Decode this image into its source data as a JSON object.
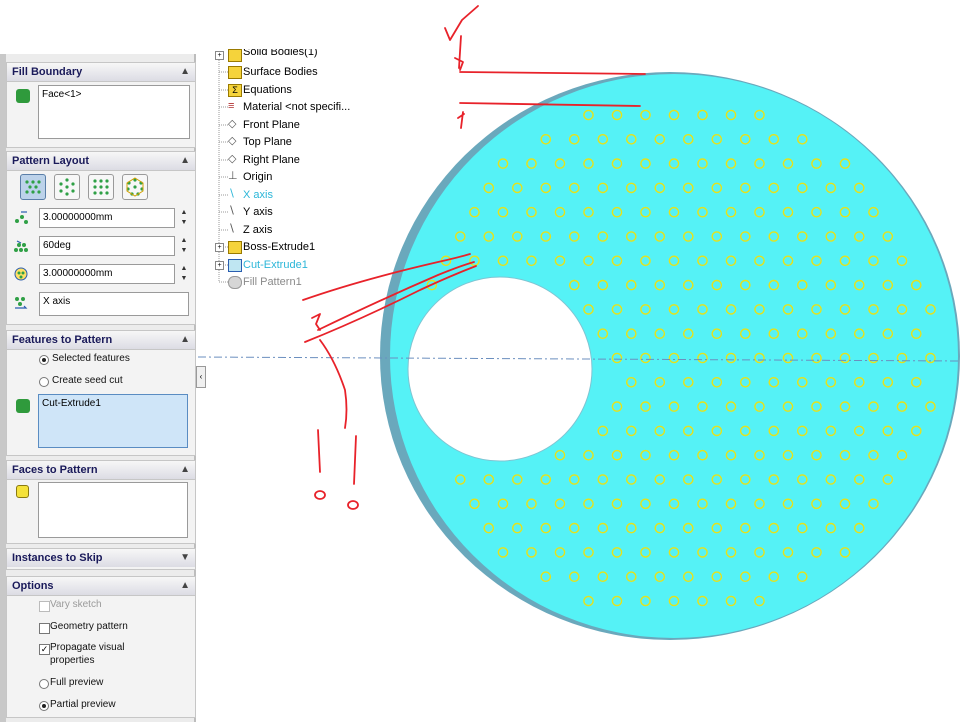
{
  "fill_boundary": {
    "header": "Fill Boundary",
    "selection": "Face<1>"
  },
  "pattern_layout": {
    "header": "Pattern Layout",
    "spacing": "3.00000000mm",
    "angle": "60deg",
    "margin": "3.00000000mm",
    "direction": "X axis"
  },
  "features_to_pattern": {
    "header": "Features to Pattern",
    "option_selected": "Selected features",
    "option_seed": "Create seed cut",
    "selection": "Cut-Extrude1"
  },
  "faces_to_pattern": {
    "header": "Faces to Pattern"
  },
  "instances_to_skip": {
    "header": "Instances to Skip"
  },
  "options": {
    "header": "Options",
    "vary_sketch": "Vary sketch",
    "geometry_pattern": "Geometry pattern",
    "propagate_1": "Propagate visual",
    "propagate_2": "properties",
    "full_preview": "Full preview",
    "partial_preview": "Partial preview"
  },
  "tree": {
    "solid_bodies": "Solid Bodies(1)",
    "surface_bodies": "Surface Bodies",
    "equations": "Equations",
    "material": "Material <not specifi...",
    "front_plane": "Front Plane",
    "top_plane": "Top Plane",
    "right_plane": "Right Plane",
    "origin": "Origin",
    "x_axis": "X axis",
    "y_axis": "Y axis",
    "z_axis": "Z axis",
    "boss_extrude": "Boss-Extrude1",
    "cut_extrude": "Cut-Extrude1",
    "fill_pattern": "Fill Pattern1"
  },
  "colors": {
    "disc": "#55f2f6",
    "disc_edge": "#6fb6c8",
    "hole_marker": "#e6e21a",
    "annotation": "#e8222a",
    "axis_line": "#6b8fbf"
  },
  "icons": [
    "boundary-face-icon",
    "spacing-icon",
    "angle-icon",
    "margin-icon",
    "direction-icon",
    "feature-icon",
    "face-icon",
    "chevron-up-icon",
    "chevron-down-icon"
  ]
}
